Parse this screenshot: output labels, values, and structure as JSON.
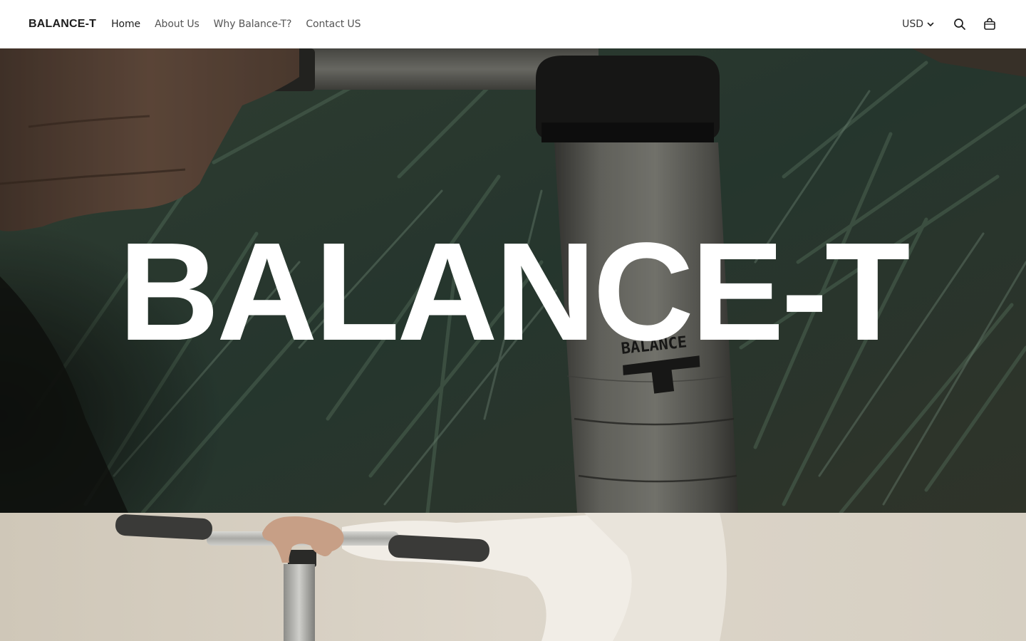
{
  "header": {
    "logo": "BALANCE-T",
    "nav": [
      {
        "label": "Home",
        "active": true
      },
      {
        "label": "About Us",
        "active": false
      },
      {
        "label": "Why Balance-T?",
        "active": false
      },
      {
        "label": "Contact US",
        "active": false
      }
    ],
    "currency": "USD",
    "icons": {
      "currency": "chevron-down-icon",
      "search": "search-icon",
      "cart": "bag-icon"
    }
  },
  "hero": {
    "title": "BALANCE-T",
    "image_text": "BALANCE"
  },
  "colors": {
    "header_bg": "#ffffff",
    "text_primary": "#1c1c1c",
    "text_nav": "#555555",
    "hero_title": "#ffffff",
    "section2_bg": "#d9d2c6"
  }
}
